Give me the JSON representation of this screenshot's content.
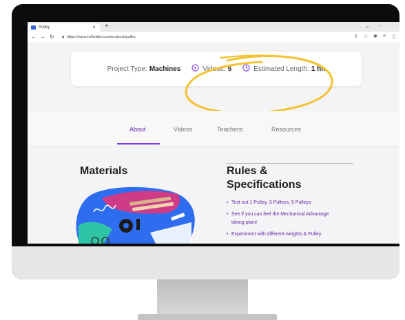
{
  "browser": {
    "tab_title": "Pulley",
    "new_tab_symbol": "+",
    "close_symbol": "×",
    "url": "https://www.hellosbix.com/projects/pulley"
  },
  "project_info": {
    "type_label": "Project Type:",
    "type_value": "Machines",
    "videos_label": "Videos:",
    "videos_value": "5",
    "length_label": "Estimated Length:",
    "length_value": "1 hr."
  },
  "page_tabs": [
    {
      "label": "About",
      "active": true
    },
    {
      "label": "Videos",
      "active": false
    },
    {
      "label": "Teachers:",
      "active": false
    },
    {
      "label": "Resources",
      "active": false
    }
  ],
  "materials": {
    "title": "Materials"
  },
  "rules": {
    "title_line1": "Rules &",
    "title_line2": "Specifications",
    "items": [
      "Test out 1 Pulley, 3 Pulleys, 5 Pulleys",
      "See if you can feel the Mechanical Advantage taking place",
      "Experiment with different weights & Pulley"
    ]
  },
  "colors": {
    "accent": "#7c3aed",
    "highlight": "#f2c230",
    "monitor_frame": "#0b0b0b",
    "monitor_chin": "#e6e6e6"
  },
  "icons": [
    "play-circle-icon",
    "clock-icon",
    "lock-icon",
    "back-arrow-icon",
    "forward-arrow-icon",
    "reload-icon"
  ]
}
